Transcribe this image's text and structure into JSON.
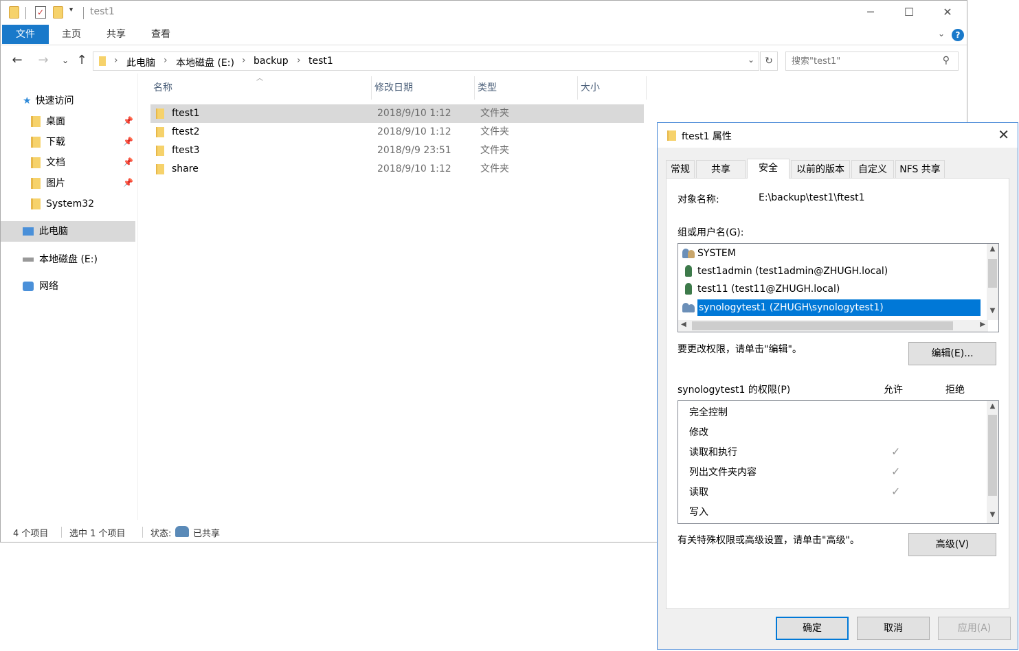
{
  "explorer": {
    "title": "test1",
    "ribbon_tabs": [
      "文件",
      "主页",
      "共享",
      "查看"
    ],
    "breadcrumb": [
      "此电脑",
      "本地磁盘 (E:)",
      "backup",
      "test1"
    ],
    "search_placeholder": "搜索\"test1\"",
    "nav": {
      "quick_access": "快速访问",
      "items": [
        "桌面",
        "下载",
        "文档",
        "图片",
        "System32"
      ],
      "this_pc": "此电脑",
      "local_disk": "本地磁盘 (E:)",
      "network": "网络"
    },
    "columns": [
      "名称",
      "修改日期",
      "类型",
      "大小"
    ],
    "files": [
      {
        "name": "ftest1",
        "date": "2018/9/10 1:12",
        "type": "文件夹"
      },
      {
        "name": "ftest2",
        "date": "2018/9/10 1:12",
        "type": "文件夹"
      },
      {
        "name": "ftest3",
        "date": "2018/9/9 23:51",
        "type": "文件夹"
      },
      {
        "name": "share",
        "date": "2018/9/10 1:12",
        "type": "文件夹"
      }
    ],
    "status": {
      "count": "4 个项目",
      "selected": "选中 1 个项目",
      "state_label": "状态:",
      "state_value": "已共享"
    }
  },
  "dialog": {
    "title": "ftest1 属性",
    "tabs": [
      "常规",
      "共享",
      "安全",
      "以前的版本",
      "自定义",
      "NFS 共享"
    ],
    "object_label": "对象名称:",
    "object_value": "E:\\backup\\test1\\ftest1",
    "group_label": "组或用户名(G):",
    "users": [
      "SYSTEM",
      "test1admin (test1admin@ZHUGH.local)",
      "test11 (test11@ZHUGH.local)",
      "synologytest1 (ZHUGH\\synologytest1)"
    ],
    "edit_hint": "要更改权限，请单击\"编辑\"。",
    "edit_button": "编辑(E)...",
    "perm_label": "synologytest1 的权限(P)",
    "allow_label": "允许",
    "deny_label": "拒绝",
    "permissions": [
      {
        "name": "完全控制",
        "allow": false
      },
      {
        "name": "修改",
        "allow": false
      },
      {
        "name": "读取和执行",
        "allow": true
      },
      {
        "name": "列出文件夹内容",
        "allow": true
      },
      {
        "name": "读取",
        "allow": true
      },
      {
        "name": "写入",
        "allow": false
      }
    ],
    "advanced_hint": "有关特殊权限或高级设置，请单击\"高级\"。",
    "advanced_button": "高级(V)",
    "ok_button": "确定",
    "cancel_button": "取消",
    "apply_button": "应用(A)"
  }
}
